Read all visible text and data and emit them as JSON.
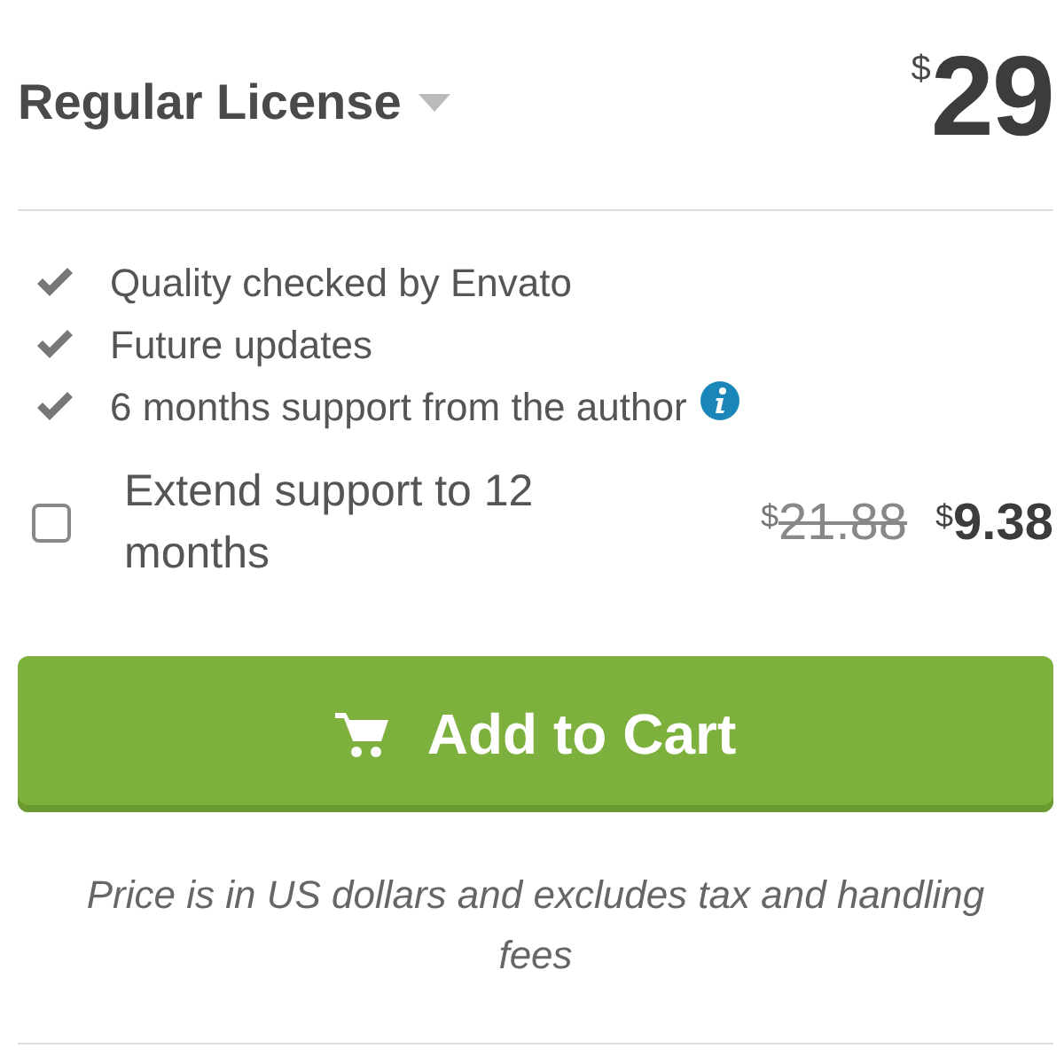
{
  "license": {
    "title": "Regular License",
    "currency": "$",
    "price": "29"
  },
  "features": [
    {
      "text": "Quality checked by Envato",
      "info": false
    },
    {
      "text": "Future updates",
      "info": false
    },
    {
      "text": "6 months support from the author",
      "info": true
    }
  ],
  "extend": {
    "label": "Extend support to 12 months",
    "checked": false,
    "old_currency": "$",
    "old_price": "21.88",
    "new_currency": "$",
    "new_price": "9.38"
  },
  "button": {
    "label": "Add to Cart"
  },
  "note": "Price is in US dollars and excludes tax and handling fees"
}
